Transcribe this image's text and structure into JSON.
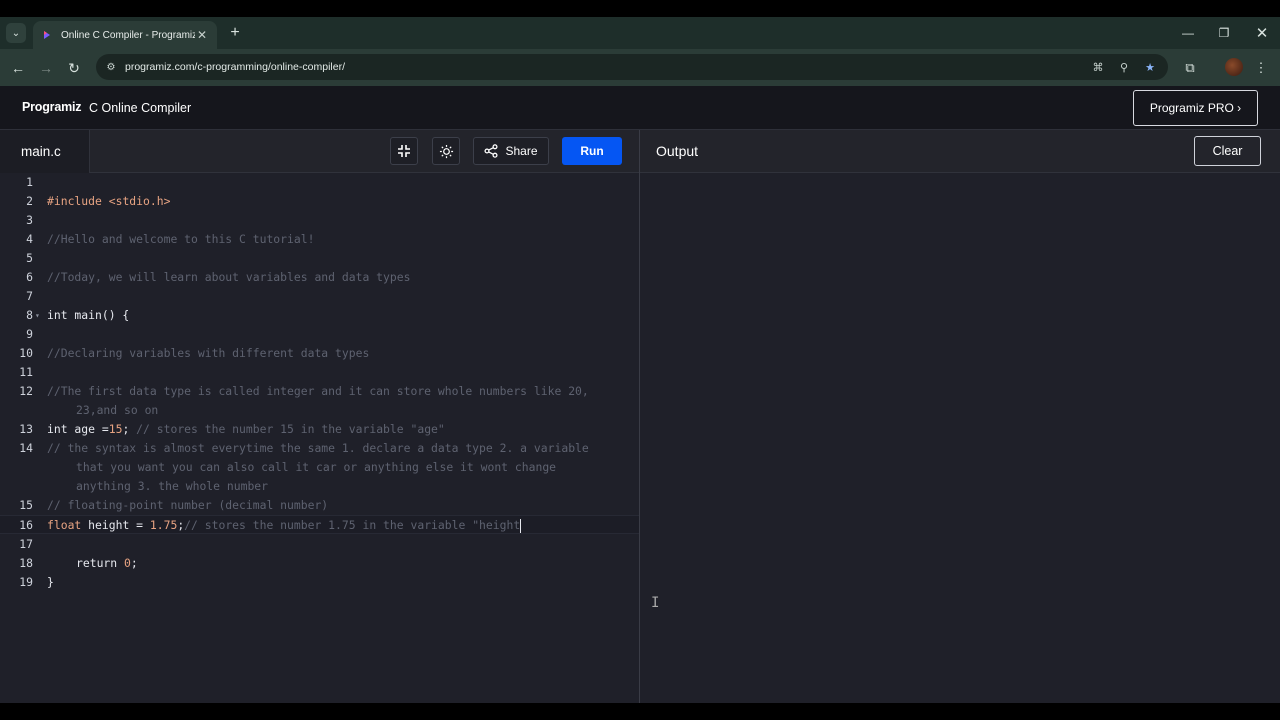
{
  "browser": {
    "tab_title": "Online C Compiler - Programiz",
    "url": "programiz.com/c-programming/online-compiler/"
  },
  "header": {
    "logo": "Programiz",
    "title": "C Online Compiler",
    "pro_button": "Programiz PRO ›"
  },
  "editor": {
    "file_tab": "main.c",
    "share_label": "Share",
    "run_label": "Run",
    "active_line": 16,
    "line_numbers": [
      "1",
      "2",
      "3",
      "4",
      "5",
      "6",
      "7",
      "8",
      "9",
      "10",
      "11",
      "12",
      "13",
      "14",
      "15",
      "16",
      "17",
      "18",
      "19"
    ],
    "lines": {
      "l2_directive": "#include",
      "l2_header": "<stdio.h>",
      "l4": "//Hello and welcome to this C tutorial!",
      "l6": "//Today, we will learn about variables and data types",
      "l8": "int main() {",
      "l10": "//Declaring variables with different data types",
      "l12a": "//The first data type is called integer and it can store whole numbers like 20,",
      "l12b": "23,and so on",
      "l13_decl": "int age =",
      "l13_num": "15",
      "l13_semi": "; ",
      "l13_cmt": "// stores the number 15 in the variable \"age\"",
      "l14a": "// the syntax is almost everytime the same 1. declare a data type 2. a variable",
      "l14b": "that you want you can also call it car or anything else it wont change",
      "l14c": "anything 3. the whole number",
      "l15": "// floating-point number (decimal number)",
      "l16_kw": "float",
      "l16_decl": " height = ",
      "l16_num": "1.75",
      "l16_semi": ";",
      "l16_cmt": "// stores the number 1.75 in the variable \"height",
      "l18_kw": "return ",
      "l18_num": "0",
      "l18_semi": ";",
      "l19": "}"
    }
  },
  "output": {
    "title": "Output",
    "clear_label": "Clear"
  },
  "colors": {
    "run_button": "#0556f3",
    "editor_bg": "#1f2029",
    "comment": "#5e6270",
    "literal": "#e7a382"
  }
}
